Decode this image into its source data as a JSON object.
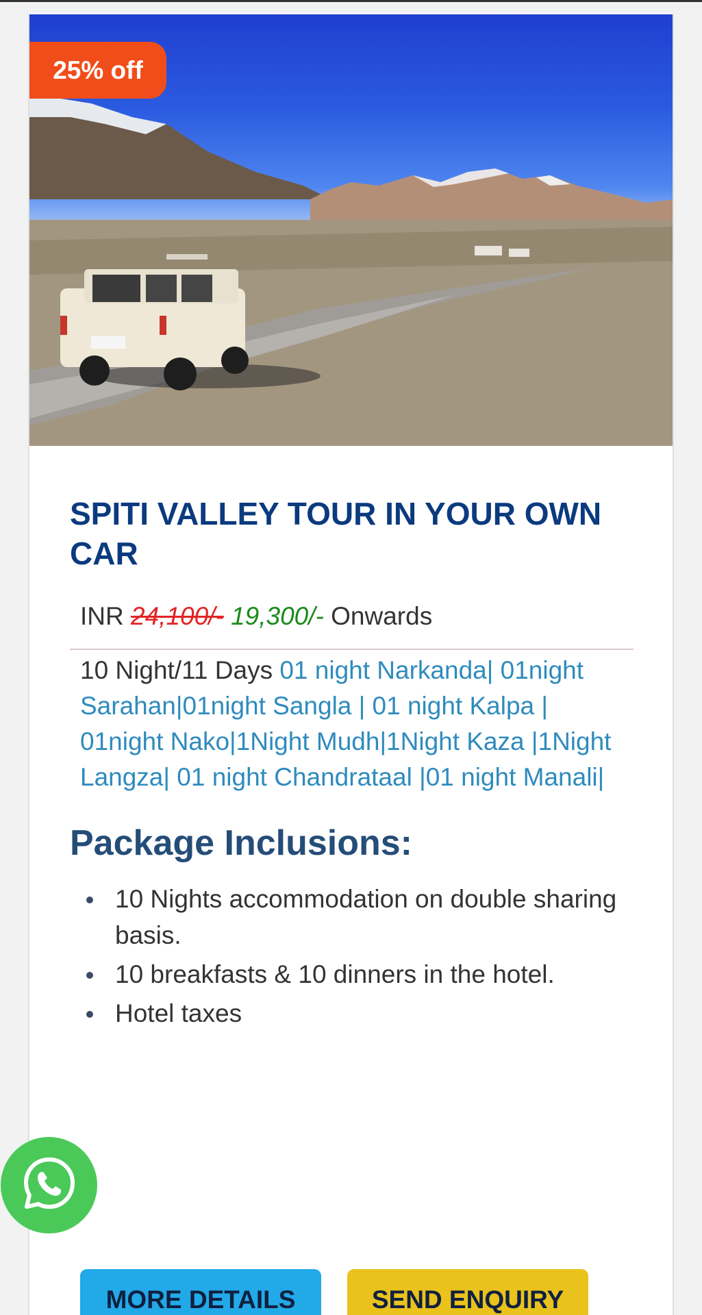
{
  "offer": {
    "badge": "25% off"
  },
  "tour": {
    "title": "SPITI VALLEY TOUR IN YOUR OWN CAR",
    "price": {
      "currency": "INR",
      "original": "24,100/-",
      "discounted": "19,300/-",
      "suffix": "Onwards"
    },
    "duration": "10 Night/11 Days",
    "stops": "01 night Narkanda| 01night Sarahan|01night Sangla | 01 night Kalpa | 01night Nako|1Night Mudh|1Night Kaza |1Night Langza| 01 night Chandrataal |01 night Manali|"
  },
  "inclusions": {
    "heading": "Package Inclusions:",
    "items": [
      "10 Nights accommodation on double sharing basis.",
      "10 breakfasts & 10 dinners in the hotel.",
      "Hotel taxes"
    ]
  },
  "buttons": {
    "more_details": "MORE DETAILS",
    "send_enquiry": "SEND ENQUIRY"
  },
  "icons": {
    "floating": "whatsapp-icon"
  },
  "colors": {
    "badge": "#f04d1b",
    "title": "#0b3a7e",
    "price_old": "#e32424",
    "price_new": "#1a8a1a",
    "stops": "#2e8bbd",
    "more_details_button": "#22a9e8",
    "send_enquiry_button": "#e9c21c",
    "whatsapp": "#4ac959"
  }
}
